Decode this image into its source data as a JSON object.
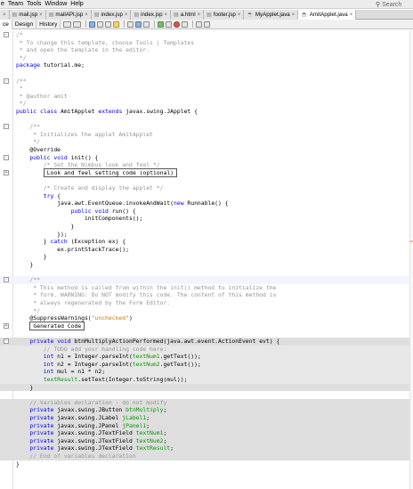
{
  "menubar": {
    "items": [
      "e",
      "Team",
      "Tools",
      "Window",
      "Help"
    ],
    "search_placeholder": "Search"
  },
  "tabs": [
    {
      "label": "",
      "active": false
    },
    {
      "label": "mail.jsp",
      "active": false
    },
    {
      "label": "mailAPI.jsp",
      "active": false
    },
    {
      "label": "index.jsp",
      "active": false
    },
    {
      "label": "index.jsp",
      "active": false
    },
    {
      "label": "a.html",
      "active": false
    },
    {
      "label": "footer.jsp",
      "active": false
    },
    {
      "label": "MyApplet.java",
      "active": false
    },
    {
      "label": "AmitApplet.java",
      "active": true
    }
  ],
  "toolbar": {
    "view_tabs": [
      "ce",
      "Design",
      "History"
    ],
    "selected_view": "ce",
    "icons": [
      "back-icon",
      "forward-icon",
      "find-icon",
      "find-previous-icon",
      "find-next-icon",
      "toggle-highlight-icon",
      "toggle-rectangular-icon",
      "toggle-bookmark-icon",
      "previous-bookmark-icon",
      "next-bookmark-icon",
      "shift-left-icon",
      "shift-right-icon",
      "start-macro-icon",
      "stop-macro-icon",
      "comment-icon",
      "uncomment-icon"
    ]
  },
  "editor": {
    "lines": [
      {
        "kind": "plain",
        "text": "/*",
        "cls": "cm",
        "fold": "-"
      },
      {
        "kind": "plain",
        "text": " * To change this template, choose Tools | Templates",
        "cls": "cm"
      },
      {
        "kind": "plain",
        "text": " * and open the template in the editor.",
        "cls": "cm"
      },
      {
        "kind": "plain",
        "text": " */",
        "cls": "cm"
      },
      {
        "kind": "plain",
        "text": "package tutorial.me;",
        "cls": "pkg"
      },
      {
        "kind": "blank"
      },
      {
        "kind": "plain",
        "text": "/**",
        "cls": "cm",
        "fold": "-"
      },
      {
        "kind": "plain",
        "text": " *",
        "cls": "cm"
      },
      {
        "kind": "plain",
        "text": " * @author amit",
        "cls": "cm"
      },
      {
        "kind": "plain",
        "text": " */",
        "cls": "cm"
      },
      {
        "kind": "plain",
        "text": "public class AmitApplet extends javax.swing.JApplet {",
        "cls": "classdecl"
      },
      {
        "kind": "blank"
      },
      {
        "kind": "plain",
        "text": "    /**",
        "cls": "cm",
        "fold": "-"
      },
      {
        "kind": "plain",
        "text": "     * Initializes the applet AmitApplet",
        "cls": "cm"
      },
      {
        "kind": "plain",
        "text": "     */",
        "cls": "cm"
      },
      {
        "kind": "plain",
        "text": "    @Override",
        "cls": "ann"
      },
      {
        "kind": "plain",
        "text": "    public void init() {",
        "cls": "init",
        "fold": "-"
      },
      {
        "kind": "plain",
        "text": "        /* Set the Nimbus look and feel */",
        "cls": "cm"
      },
      {
        "kind": "plain",
        "text": "        Look and feel setting code (optional)",
        "cls": "box",
        "fold": "+"
      },
      {
        "kind": "blank"
      },
      {
        "kind": "plain",
        "text": "        /* Create and display the applet */",
        "cls": "cm"
      },
      {
        "kind": "plain",
        "text": "        try {",
        "cls": "try"
      },
      {
        "kind": "plain",
        "text": "            java.awt.EventQueue.invokeAndWait(new Runnable() {",
        "cls": "invoke"
      },
      {
        "kind": "plain",
        "text": "                public void run() {",
        "cls": "run"
      },
      {
        "kind": "plain",
        "text": "                    initComponents();",
        "cls": "plain"
      },
      {
        "kind": "plain",
        "text": "                }",
        "cls": "plain"
      },
      {
        "kind": "plain",
        "text": "            });",
        "cls": "plain"
      },
      {
        "kind": "plain",
        "text": "        } catch (Exception ex) {",
        "cls": "catch"
      },
      {
        "kind": "plain",
        "text": "            ex.printStackTrace();",
        "cls": "plain"
      },
      {
        "kind": "plain",
        "text": "        }",
        "cls": "plain"
      },
      {
        "kind": "plain",
        "text": "    }",
        "cls": "plain"
      },
      {
        "kind": "blank"
      },
      {
        "kind": "plain",
        "text": "    /**",
        "cls": "cm",
        "fold": "-",
        "caret": true
      },
      {
        "kind": "plain",
        "text": "     * This method is called from within the init() method to initialize the",
        "cls": "cm"
      },
      {
        "kind": "plain",
        "text": "     * form. WARNING: Do NOT modify this code. The content of this method is",
        "cls": "cm"
      },
      {
        "kind": "plain",
        "text": "     * always regenerated by the Form Editor.",
        "cls": "cm"
      },
      {
        "kind": "plain",
        "text": "     */",
        "cls": "cm"
      },
      {
        "kind": "plain",
        "text": "    @SuppressWarnings(\"unchecked\")",
        "cls": "suppress"
      },
      {
        "kind": "plain",
        "text": "    Generated Code",
        "cls": "gen",
        "fold": "+"
      },
      {
        "kind": "blank"
      },
      {
        "kind": "plain",
        "text": "    private void btnMultiplyActionPerformed(java.awt.event.ActionEvent evt) {",
        "cls": "method",
        "fold": "-",
        "guard": true
      },
      {
        "kind": "plain",
        "text": "        // TODO add your handling code here:",
        "cls": "cm",
        "hl": true
      },
      {
        "kind": "plain",
        "text": "        int n1 = Integer.parseInt(textNum1.getText());",
        "cls": "n1",
        "hl": true
      },
      {
        "kind": "plain",
        "text": "        int n2 = Integer.parseInt(textNum2.getText());",
        "cls": "n2",
        "hl": true
      },
      {
        "kind": "plain",
        "text": "        int mul = n1 * n2;",
        "cls": "mul",
        "hl": true
      },
      {
        "kind": "plain",
        "text": "        textResult.setText(Integer.toString(mul));",
        "cls": "res",
        "hl": true
      },
      {
        "kind": "plain",
        "text": "    }",
        "cls": "plain",
        "guard": true
      },
      {
        "kind": "blank"
      },
      {
        "kind": "plain",
        "text": "    // Variables declaration - do not modify",
        "cls": "cm",
        "guard": true
      },
      {
        "kind": "plain",
        "text": "    private javax.swing.JButton btnMultiply;",
        "cls": "decl",
        "guard": true
      },
      {
        "kind": "plain",
        "text": "    private javax.swing.JLabel jLabel1;",
        "cls": "decl",
        "guard": true
      },
      {
        "kind": "plain",
        "text": "    private javax.swing.JPanel jPanel1;",
        "cls": "decl",
        "guard": true
      },
      {
        "kind": "plain",
        "text": "    private javax.swing.JTextField textNum1;",
        "cls": "decl",
        "guard": true
      },
      {
        "kind": "plain",
        "text": "    private javax.swing.JTextField textNum2;",
        "cls": "decl",
        "guard": true
      },
      {
        "kind": "plain",
        "text": "    private javax.swing.JTextField textResult;",
        "cls": "decl",
        "guard": true
      },
      {
        "kind": "plain",
        "text": "    // End of variables declaration",
        "cls": "cm",
        "guard": true
      },
      {
        "kind": "plain",
        "text": "}",
        "cls": "plain"
      }
    ]
  }
}
